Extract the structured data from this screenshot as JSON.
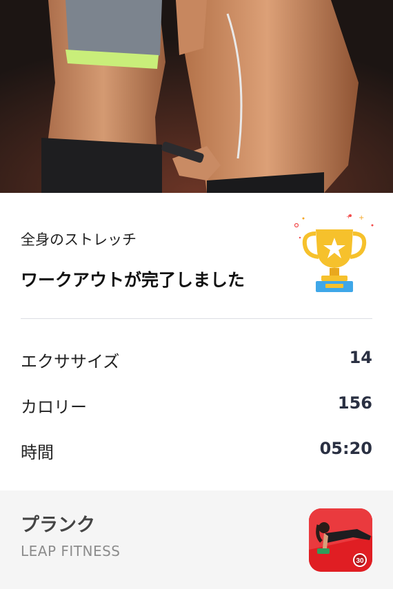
{
  "hero": {
    "image": "two-fit-people-photo"
  },
  "summary": {
    "workout_name": "全身のストレッチ",
    "completed_text": "ワークアウトが完了しました",
    "trophy_icon": "trophy-icon"
  },
  "stats": [
    {
      "label": "エクササイズ",
      "value": "14"
    },
    {
      "label": "カロリー",
      "value": "156"
    },
    {
      "label": "時間",
      "value": "05:20"
    }
  ],
  "promo": {
    "title": "プランク",
    "developer": "LEAP FITNESS",
    "badge": "30",
    "icon": "plank-app-icon"
  },
  "colors": {
    "value_text": "#2a3042",
    "app_icon_bg": "#e01e23",
    "promo_bg": "#f5f5f5"
  }
}
